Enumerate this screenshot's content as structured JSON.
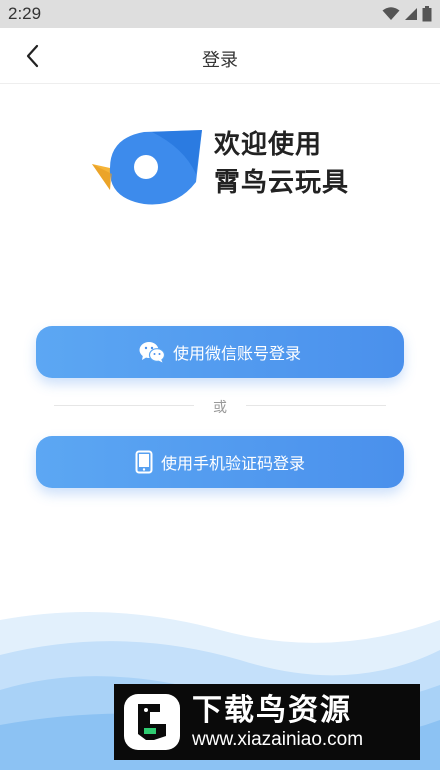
{
  "status_bar": {
    "time": "2:29"
  },
  "header": {
    "title": "登录"
  },
  "welcome": {
    "line1": "欢迎使用",
    "line2": "霄鸟云玩具"
  },
  "buttons": {
    "wechat_label": "使用微信账号登录",
    "phone_label": "使用手机验证码登录"
  },
  "divider": {
    "text": "或"
  },
  "watermark": {
    "title": "下载鸟资源",
    "url": "www.xiazainiao.com"
  },
  "colors": {
    "button": "#4a90ec",
    "logo_blue": "#3d8bec",
    "logo_yellow": "#f6b437",
    "wave": "#a9d2f7"
  }
}
